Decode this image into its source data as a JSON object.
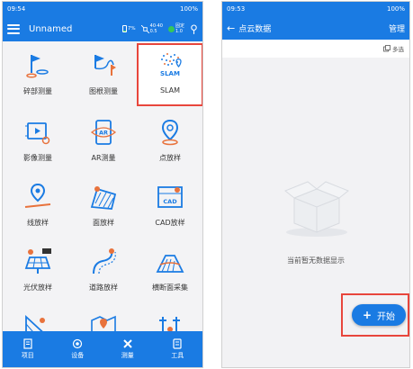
{
  "left": {
    "status": {
      "time": "09:54",
      "right": "100%"
    },
    "appbar": {
      "title": "Unnamed",
      "battery": "7%",
      "sat_top": "40·40",
      "sat_bottom": "0.5",
      "fix_label": "固定",
      "fix_value": "1.0"
    },
    "grid": [
      {
        "label": "碎部测量",
        "icon": "flag-point-icon"
      },
      {
        "label": "图根测量",
        "icon": "flag-route-icon"
      },
      {
        "label": "SLAM",
        "icon": "slam-pointcloud-icon",
        "icon_text": "SLAM",
        "highlighted": true
      },
      {
        "label": "影像测量",
        "icon": "video-camera-icon"
      },
      {
        "label": "AR测量",
        "icon": "ar-camera-icon",
        "icon_text": "AR"
      },
      {
        "label": "点放样",
        "icon": "location-pin-icon"
      },
      {
        "label": "线放样",
        "icon": "line-stakeout-icon"
      },
      {
        "label": "面放样",
        "icon": "area-stakeout-icon"
      },
      {
        "label": "CAD放样",
        "icon": "cad-stakeout-icon",
        "icon_text": "CAD"
      },
      {
        "label": "光伏放样",
        "icon": "solar-panel-icon"
      },
      {
        "label": "道路放样",
        "icon": "road-stakeout-icon"
      },
      {
        "label": "横断面采集",
        "icon": "cross-section-icon"
      },
      {
        "label": "",
        "icon": "slope-icon"
      },
      {
        "label": "",
        "icon": "map-stakeout-icon"
      },
      {
        "label": "",
        "icon": "pile-icon"
      }
    ],
    "nav": [
      {
        "label": "项目",
        "icon": "document-icon"
      },
      {
        "label": "设备",
        "icon": "device-icon"
      },
      {
        "label": "测量",
        "icon": "measure-icon"
      },
      {
        "label": "工具",
        "icon": "tools-icon"
      }
    ]
  },
  "right": {
    "status": {
      "time": "09:53",
      "right": "100%"
    },
    "appbar": {
      "back": "←",
      "title": "点云数据",
      "action": "管理"
    },
    "subbar": {
      "multi_select": "多选"
    },
    "empty_text": "当前暂无数据显示",
    "start_button": {
      "plus": "+",
      "label": "开始"
    }
  }
}
